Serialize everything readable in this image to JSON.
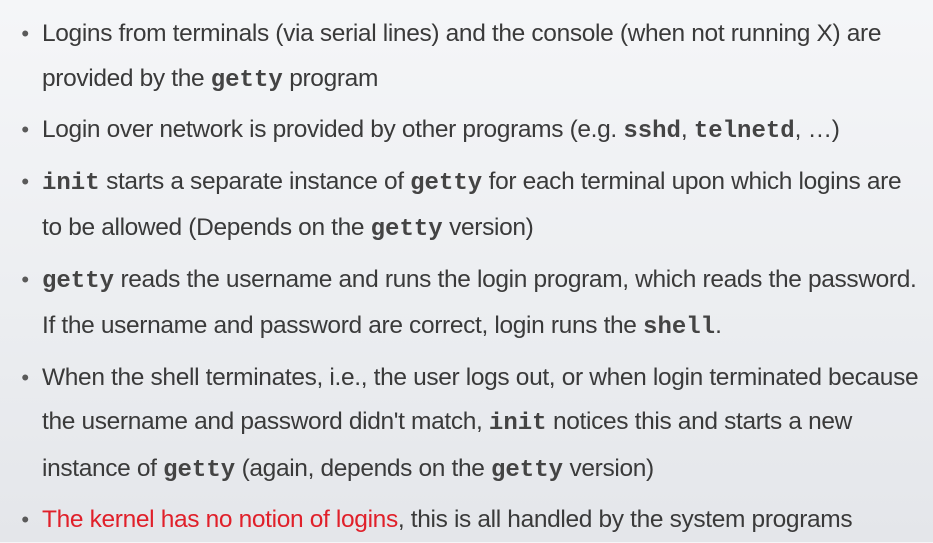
{
  "bullet_glyph": "•",
  "highlight_color": "#e0202a",
  "items": [
    {
      "segments": [
        {
          "text": "Logins from terminals (via serial lines) and the console (when not running X) are provided by the "
        },
        {
          "text": "getty",
          "code": true
        },
        {
          "text": " program"
        }
      ]
    },
    {
      "segments": [
        {
          "text": "Login over network is provided by other programs (e.g. "
        },
        {
          "text": "sshd",
          "code": true
        },
        {
          "text": ", "
        },
        {
          "text": "telnetd",
          "code": true
        },
        {
          "text": ", …)"
        }
      ]
    },
    {
      "segments": [
        {
          "text": "init",
          "code": true
        },
        {
          "text": " starts a separate instance of "
        },
        {
          "text": "getty",
          "code": true
        },
        {
          "text": " for each terminal upon which logins are to be allowed (Depends on the "
        },
        {
          "text": "getty",
          "code": true
        },
        {
          "text": " version)"
        }
      ]
    },
    {
      "segments": [
        {
          "text": "getty",
          "code": true
        },
        {
          "text": " reads the username and runs the login program, which reads the password. If the username and password are correct, login runs the "
        },
        {
          "text": "shell",
          "code": true
        },
        {
          "text": "."
        }
      ]
    },
    {
      "segments": [
        {
          "text": "When the shell terminates, i.e., the user logs out, or when login terminated because the username and password didn't match, "
        },
        {
          "text": "init",
          "code": true
        },
        {
          "text": " notices this and starts a new instance of "
        },
        {
          "text": "getty",
          "code": true
        },
        {
          "text": " (again, depends on the "
        },
        {
          "text": "getty",
          "code": true
        },
        {
          "text": " version)"
        }
      ]
    },
    {
      "segments": [
        {
          "text": "The kernel has no notion of logins",
          "red": true
        },
        {
          "text": ", this is all handled by the system programs"
        }
      ]
    }
  ]
}
